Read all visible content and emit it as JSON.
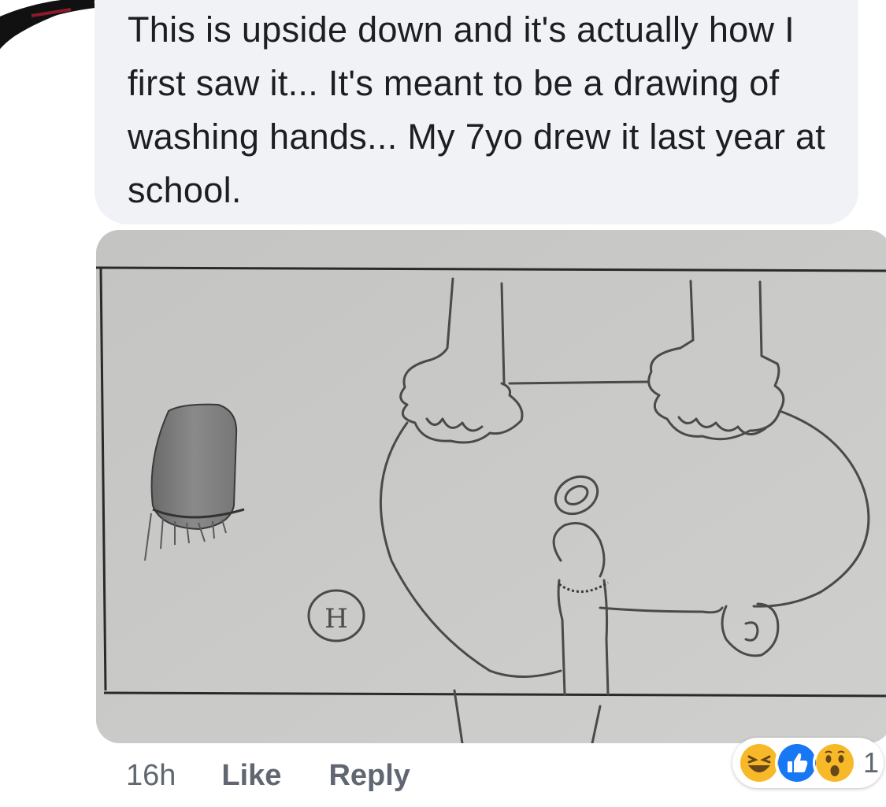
{
  "comment": {
    "text": "This is upside down and it's actually how I first saw it... It's meant to be a drawing of washing hands... My 7yo drew it last year at school."
  },
  "photo": {
    "drawing_letters": [
      "H"
    ]
  },
  "actions": {
    "time": "16h",
    "like_label": "Like",
    "reply_label": "Reply"
  },
  "reactions": {
    "icons": [
      "haha-icon",
      "like-icon",
      "wow-icon"
    ],
    "count": "1"
  },
  "colors": {
    "bubble": "#f0f2f5",
    "text": "#1c1e21",
    "meta": "#606770",
    "like_blue": "#1877f2",
    "reaction_yellow": "#f7b928"
  }
}
